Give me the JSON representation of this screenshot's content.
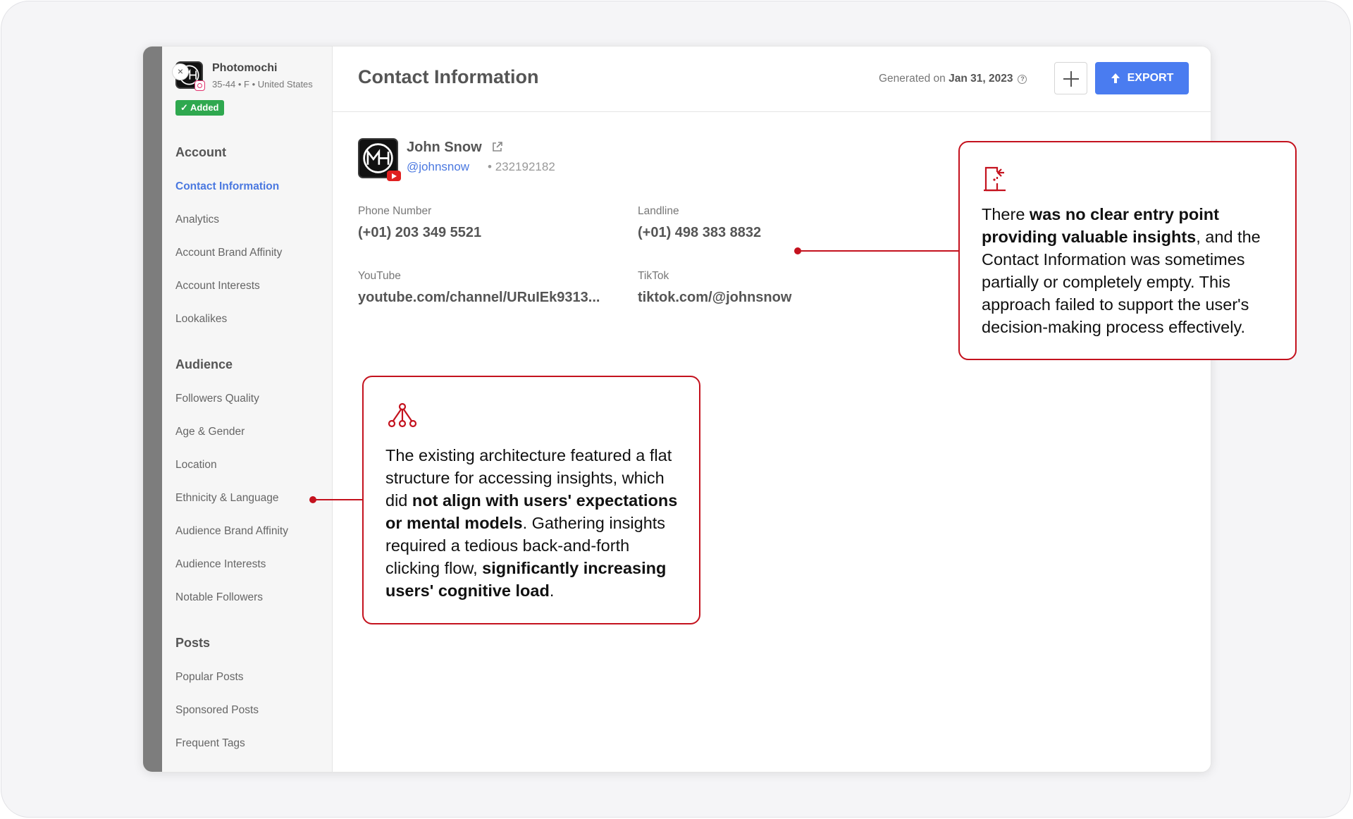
{
  "profile": {
    "name": "Photomochi",
    "meta": "35-44 • F • United States",
    "added_label": "Added"
  },
  "sidebar": {
    "sections": [
      {
        "title": "Account",
        "items": [
          "Contact Information",
          "Analytics",
          "Account Brand Affinity",
          "Account Interests",
          "Lookalikes"
        ]
      },
      {
        "title": "Audience",
        "items": [
          "Followers Quality",
          "Age & Gender",
          "Location",
          "Ethnicity & Language",
          "Audience Brand Affinity",
          "Audience Interests",
          "Notable Followers"
        ]
      },
      {
        "title": "Posts",
        "items": [
          "Popular Posts",
          "Sponsored Posts",
          "Frequent Tags"
        ]
      }
    ],
    "active_item": "Contact Information"
  },
  "header": {
    "title": "Contact Information",
    "generated_prefix": "Generated on",
    "generated_date": "Jan 31, 2023",
    "export_label": "EXPORT"
  },
  "contact": {
    "name": "John Snow",
    "handle": "@johnsnow",
    "separator": "•",
    "id": "232192182",
    "fields": [
      {
        "label": "Phone Number",
        "value": "(+01) 203 349 5521"
      },
      {
        "label": "Landline",
        "value": "(+01) 498 383 8832"
      },
      {
        "label": "YouTube",
        "value": "youtube.com/channel/URuIEk9313..."
      },
      {
        "label": "TikTok",
        "value": "tiktok.com/@johnsnow"
      }
    ]
  },
  "annotations": {
    "entry_point": {
      "icon": "exit-door-icon",
      "parts": [
        {
          "t": "There ",
          "b": false
        },
        {
          "t": "was no clear entry point providing valuable insights",
          "b": true
        },
        {
          "t": ", and the Contact Information was sometimes partially or completely empty. This approach failed to support the user's decision-making process effectively.",
          "b": false
        }
      ]
    },
    "architecture": {
      "icon": "hierarchy-icon",
      "parts": [
        {
          "t": "The existing architecture featured a flat structure for accessing insights, which did ",
          "b": false
        },
        {
          "t": "not align with users' expectations or mental models",
          "b": true
        },
        {
          "t": ". Gathering insights required a tedious back-and-forth clicking flow, ",
          "b": false
        },
        {
          "t": "significantly increasing users' cognitive load",
          "b": true
        },
        {
          "t": ".",
          "b": false
        }
      ]
    }
  },
  "colors": {
    "accent": "#4a7cf0",
    "link": "#4a78e0",
    "added_green": "#2fa84f",
    "annotation_red": "#c4121e"
  }
}
